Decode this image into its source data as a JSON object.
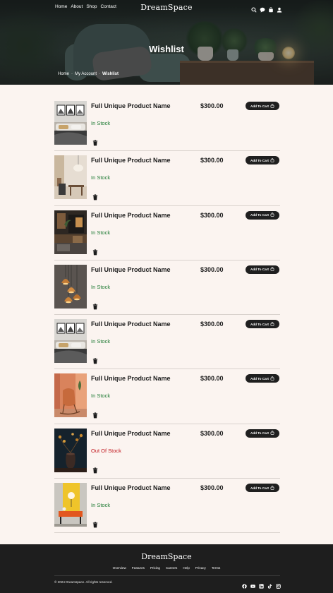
{
  "header": {
    "nav": [
      "Home",
      "About",
      "Shop",
      "Contact"
    ],
    "logo": "DreamSpace",
    "icons": [
      "search-icon",
      "chat-icon",
      "cart-icon",
      "user-icon"
    ]
  },
  "hero": {
    "title": "Wishlist",
    "breadcrumb": [
      "Home",
      "·",
      "My Account",
      "·",
      "Wishlist"
    ]
  },
  "wishlist": {
    "items": [
      {
        "name": "Full Unique Product Name",
        "price": "$300.00",
        "stock": "In Stock",
        "in_stock": true,
        "cart_label": "Add To Cart",
        "image": "bedroom-wall-art"
      },
      {
        "name": "Full Unique Product Name",
        "price": "$300.00",
        "stock": "In Stock",
        "in_stock": true,
        "cart_label": "Add To Cart",
        "image": "minimal-interior-pendant"
      },
      {
        "name": "Full Unique Product Name",
        "price": "$300.00",
        "stock": "In Stock",
        "in_stock": true,
        "cart_label": "Add To Cart",
        "image": "dark-living-room"
      },
      {
        "name": "Full Unique Product Name",
        "price": "$300.00",
        "stock": "In Stock",
        "in_stock": true,
        "cart_label": "Add To Cart",
        "image": "pendant-lamps"
      },
      {
        "name": "Full Unique Product Name",
        "price": "$300.00",
        "stock": "In Stock",
        "in_stock": true,
        "cart_label": "Add To Cart",
        "image": "bedroom-wall-art"
      },
      {
        "name": "Full Unique Product Name",
        "price": "$300.00",
        "stock": "In Stock",
        "in_stock": true,
        "cart_label": "Add To Cart",
        "image": "orange-rocking-chair"
      },
      {
        "name": "Full Unique Product Name",
        "price": "$300.00",
        "stock": "Out Of Stock",
        "in_stock": false,
        "cart_label": "Add To Cart",
        "image": "dark-vase-flowers"
      },
      {
        "name": "Full Unique Product Name",
        "price": "$300.00",
        "stock": "In Stock",
        "in_stock": true,
        "cart_label": "Add To Cart",
        "image": "yellow-console"
      }
    ]
  },
  "footer": {
    "logo": "DreamSpace",
    "links": [
      "Overview",
      "Features",
      "Pricing",
      "Careers",
      "Help",
      "Privacy",
      "Terms"
    ],
    "copyright": "© 2024 Dreamspace. All rights reserved.",
    "social": [
      "facebook-icon",
      "youtube-icon",
      "linkedin-icon",
      "tiktok-icon",
      "instagram-icon"
    ]
  },
  "colors": {
    "page_bg": "#fbf4f0",
    "in_stock": "#1e7a33",
    "out_of_stock": "#c0151c",
    "button_bg": "#1f1f1f",
    "footer_bg": "#1e1e1e"
  }
}
